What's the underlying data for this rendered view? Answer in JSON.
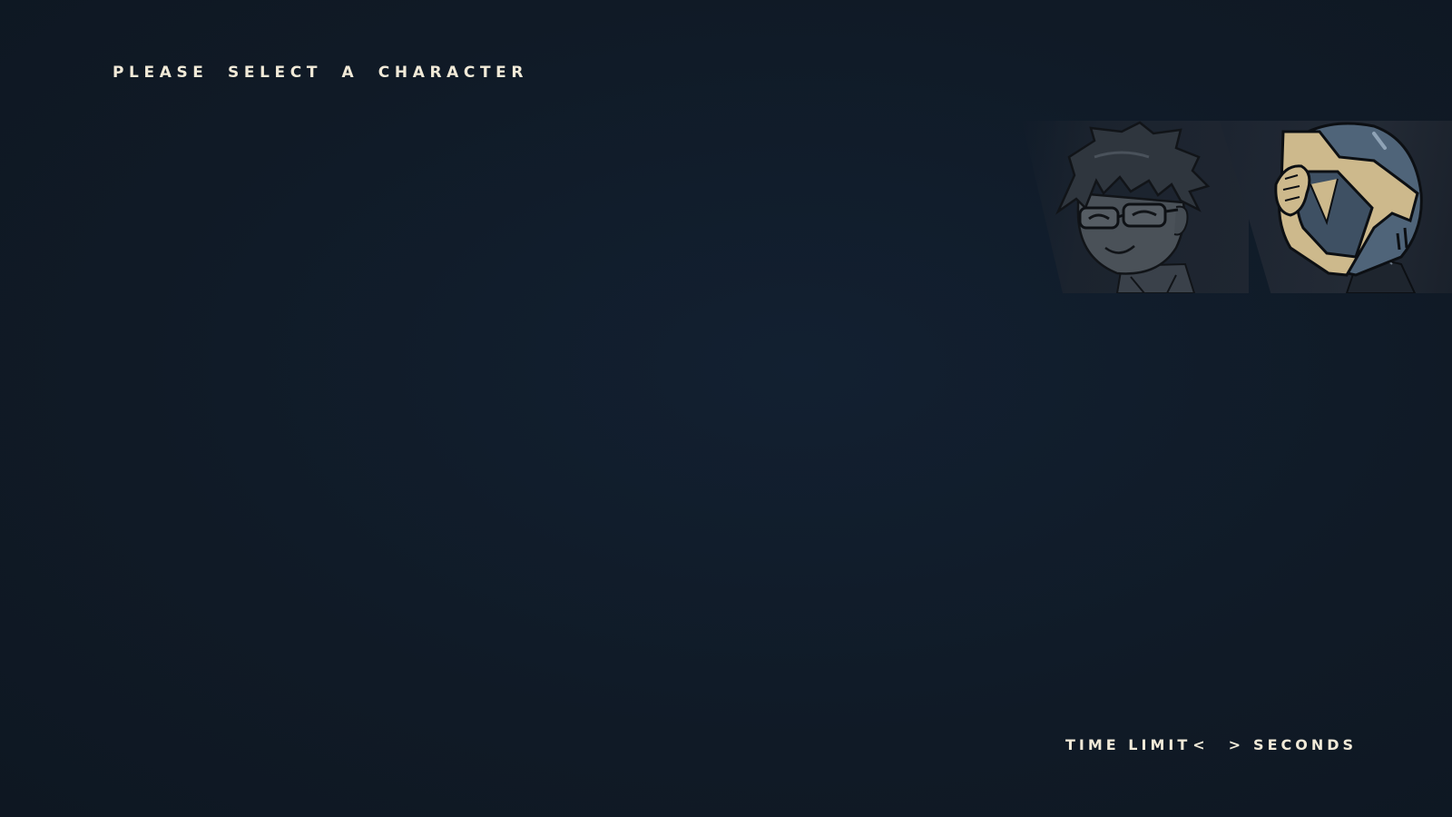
{
  "screen": {
    "prompt": "PLEASE SELECT A CHARACTER"
  },
  "roster": {
    "characters": [
      {
        "portrait": "glasses-boy-portrait"
      },
      {
        "portrait": "helmeted-figure-portrait"
      }
    ]
  },
  "settings": {
    "time_limit_label": "TIME LIMIT",
    "decrease_symbol": "<",
    "time_value": "",
    "increase_symbol": ">",
    "unit_label": "SECONDS"
  },
  "colors": {
    "background": "#101a26",
    "text": "#f1ead8",
    "helmet_gold": "#cdb98c",
    "helmet_blue": "#4f6479"
  }
}
